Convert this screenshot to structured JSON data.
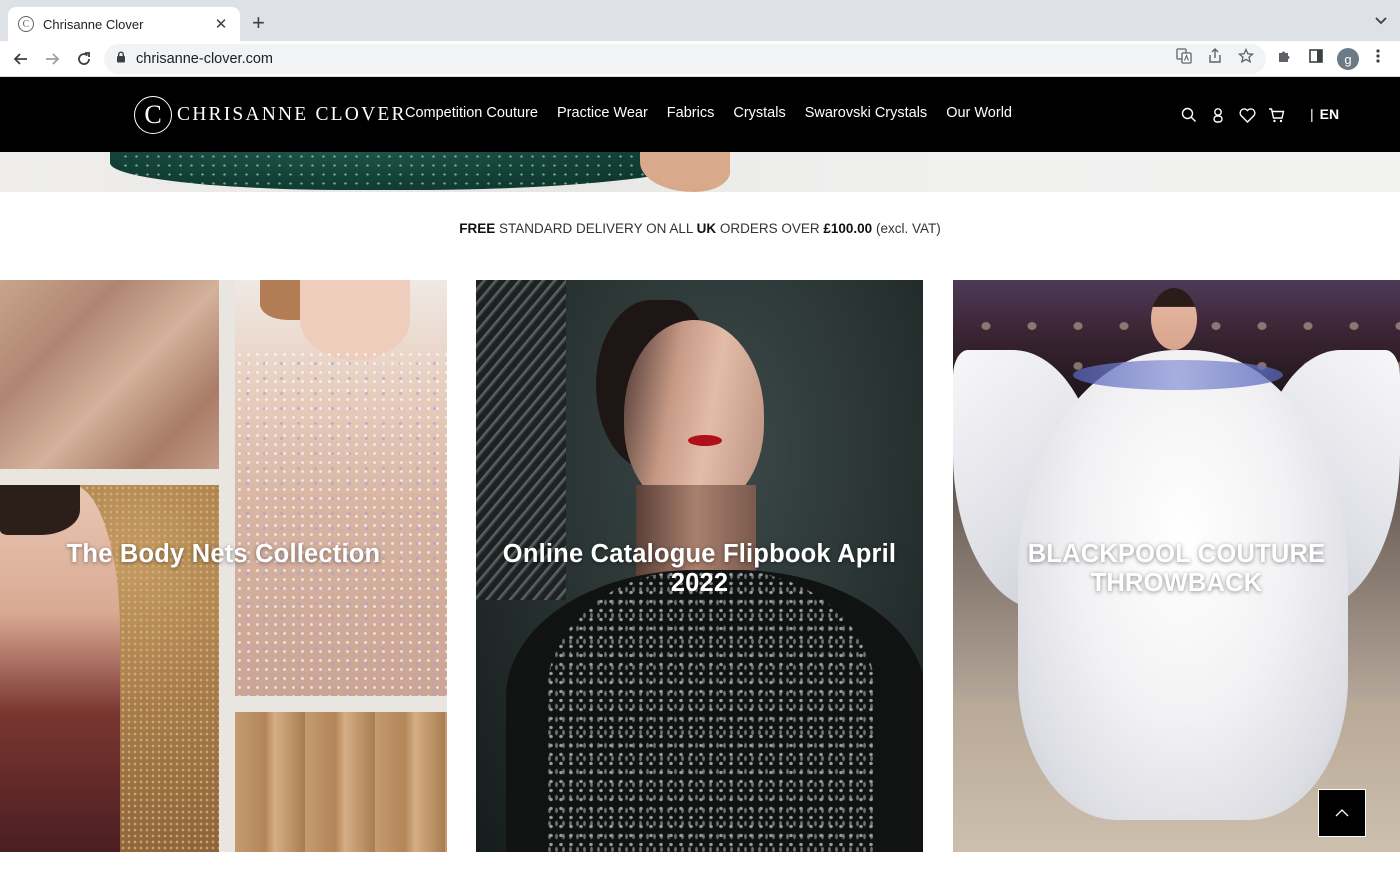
{
  "browser": {
    "tab_title": "Chrisanne Clover",
    "tab_close": "✕",
    "new_tab": "+",
    "url": "chrisanne-clover.com",
    "profile_initial": "g"
  },
  "site": {
    "logo_mark": "C",
    "logo_text": "CHRISANNE CLOVER",
    "nav": [
      "Competition Couture",
      "Practice Wear",
      "Fabrics",
      "Crystals",
      "Swarovski Crystals",
      "Our World"
    ],
    "lang_separator": "|",
    "lang": "EN"
  },
  "delivery": {
    "part1": "FREE",
    "part2": " STANDARD DELIVERY ON ALL ",
    "part3": "UK",
    "part4": " ORDERS OVER ",
    "part5": "£100.00",
    "part6": " (excl. VAT)"
  },
  "cards": [
    {
      "title": "The Body Nets Collection"
    },
    {
      "title": "Online Catalogue Flipbook April 2022"
    },
    {
      "title": "BLACKPOOL COUTURE THROWBACK"
    }
  ],
  "icons": {
    "search": "search-icon",
    "account": "account-icon",
    "wishlist": "heart-icon",
    "cart": "cart-icon",
    "back_to_top": "chevron-up-icon"
  },
  "colors": {
    "header_bg": "#000000",
    "chrome_bg": "#dee1e6"
  }
}
